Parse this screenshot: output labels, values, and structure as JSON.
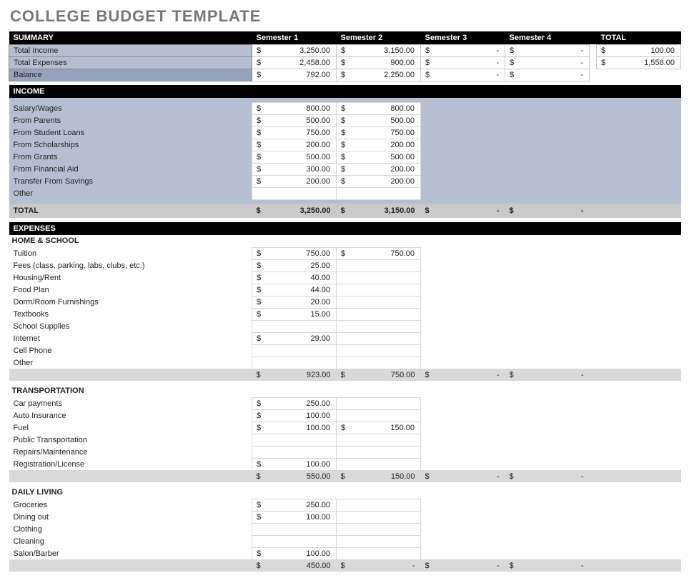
{
  "title": "COLLEGE BUDGET TEMPLATE",
  "headers": {
    "summary": "SUMMARY",
    "sem1": "Semester 1",
    "sem2": "Semester 2",
    "sem3": "Semester 3",
    "sem4": "Semester 4",
    "total": "TOTAL",
    "income": "INCOME",
    "expenses": "EXPENSES",
    "totalRow": "TOTAL"
  },
  "summary": {
    "rows": [
      {
        "label": "Total Income",
        "s1": "3,250.00",
        "s2": "3,150.00",
        "s3": "-",
        "s4": "-",
        "t": "100.00"
      },
      {
        "label": "Total Expenses",
        "s1": "2,458.00",
        "s2": "900.00",
        "s3": "-",
        "s4": "-",
        "t": "1,558.00"
      },
      {
        "label": "Balance",
        "s1": "792.00",
        "s2": "2,250.00",
        "s3": "-",
        "s4": "-",
        "t": ""
      }
    ]
  },
  "income": {
    "rows": [
      {
        "label": "Salary/Wages",
        "s1": "800.00",
        "s2": "800.00"
      },
      {
        "label": "From Parents",
        "s1": "500.00",
        "s2": "500.00"
      },
      {
        "label": "From Student Loans",
        "s1": "750.00",
        "s2": "750.00"
      },
      {
        "label": "From Scholarships",
        "s1": "200.00",
        "s2": "200.00"
      },
      {
        "label": "From Grants",
        "s1": "500.00",
        "s2": "500.00"
      },
      {
        "label": "From Financial Aid",
        "s1": "300.00",
        "s2": "200.00"
      },
      {
        "label": "Transfer From Savings",
        "s1": "200.00",
        "s2": "200.00"
      },
      {
        "label": "Other",
        "s1": "",
        "s2": ""
      }
    ],
    "total": {
      "s1": "3,250.00",
      "s2": "3,150.00",
      "s3": "-",
      "s4": "-"
    }
  },
  "expenses": {
    "sections": [
      {
        "title": "HOME & SCHOOL",
        "rows": [
          {
            "label": "Tuition",
            "s1": "750.00",
            "s2": "750.00"
          },
          {
            "label": "Fees (class, parking, labs, clubs, etc.)",
            "s1": "25.00",
            "s2": ""
          },
          {
            "label": "Housing/Rent",
            "s1": "40.00",
            "s2": ""
          },
          {
            "label": "Food Plan",
            "s1": "44.00",
            "s2": ""
          },
          {
            "label": "Dorm/Room Furnishings",
            "s1": "20.00",
            "s2": ""
          },
          {
            "label": "Textbooks",
            "s1": "15.00",
            "s2": ""
          },
          {
            "label": "School Supplies",
            "s1": "",
            "s2": ""
          },
          {
            "label": "Internet",
            "s1": "29.00",
            "s2": ""
          },
          {
            "label": "Cell Phone",
            "s1": "",
            "s2": ""
          },
          {
            "label": "Other",
            "s1": "",
            "s2": ""
          }
        ],
        "subtotal": {
          "s1": "923.00",
          "s2": "750.00",
          "s3": "-",
          "s4": "-"
        }
      },
      {
        "title": "TRANSPORTATION",
        "rows": [
          {
            "label": "Car payments",
            "s1": "250.00",
            "s2": ""
          },
          {
            "label": "Auto Insurance",
            "s1": "100.00",
            "s2": ""
          },
          {
            "label": "Fuel",
            "s1": "100.00",
            "s2": "150.00"
          },
          {
            "label": "Public Transportation",
            "s1": "",
            "s2": ""
          },
          {
            "label": "Repairs/Maintenance",
            "s1": "",
            "s2": ""
          },
          {
            "label": "Registration/License",
            "s1": "100.00",
            "s2": ""
          }
        ],
        "subtotal": {
          "s1": "550.00",
          "s2": "150.00",
          "s3": "-",
          "s4": "-"
        }
      },
      {
        "title": "DAILY LIVING",
        "rows": [
          {
            "label": "Groceries",
            "s1": "250.00",
            "s2": ""
          },
          {
            "label": "Dining out",
            "s1": "100.00",
            "s2": ""
          },
          {
            "label": "Clothing",
            "s1": "",
            "s2": ""
          },
          {
            "label": "Cleaning",
            "s1": "",
            "s2": ""
          },
          {
            "label": "Salon/Barber",
            "s1": "100.00",
            "s2": ""
          }
        ],
        "subtotal": {
          "s1": "450.00",
          "s2": "-",
          "s3": "-",
          "s4": "-"
        }
      }
    ]
  }
}
